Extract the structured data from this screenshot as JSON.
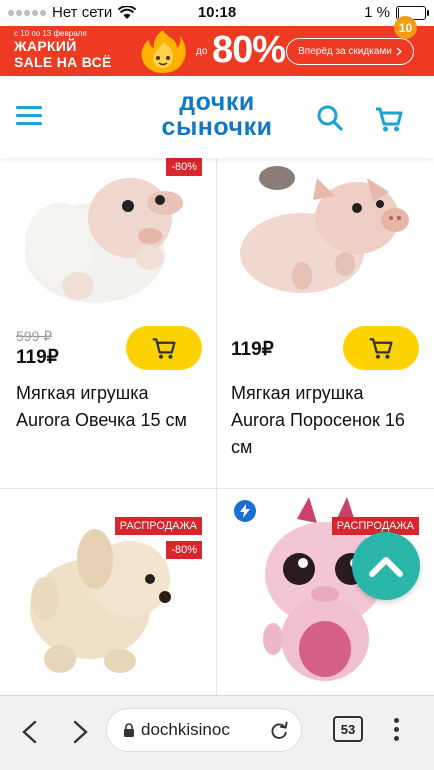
{
  "status_bar": {
    "carrier": "Нет сети",
    "time": "10:18",
    "battery": "1 %",
    "battery_level": 0.05
  },
  "banner": {
    "dates": "с 10 по 13 февраля",
    "title_line1": "ЖАРКИЙ",
    "title_line2": "SALE НА ВСЁ",
    "prefix": "до",
    "percent": "80%",
    "cta": "Вперёд за скидками",
    "color": "#ee3a23"
  },
  "header": {
    "logo_line1": "дочки",
    "logo_line2": "сыночки",
    "cart_count": "10",
    "brand_color": "#1079c4"
  },
  "products": [
    {
      "discount": "-80%",
      "old_price": "599 ₽",
      "price": "119₽",
      "name": "Мягкая игрушка Aurora Овечка 15 см"
    },
    {
      "price": "119₽",
      "name": "Мягкая игрушка Aurora Поросенок 16 см"
    },
    {
      "sale_badge": "РАСПРОДАЖА",
      "discount": "-80%"
    },
    {
      "sale_badge": "РАСПРОДАЖА",
      "icon": "lightning-icon"
    }
  ],
  "browser": {
    "url": "dochkisinoc",
    "tab_count": "53"
  },
  "colors": {
    "cart_button": "#fcd200",
    "sale_badge": "#d9252c",
    "scroll_top": "#2ab7a9",
    "cart_badge": "#f39c12"
  }
}
